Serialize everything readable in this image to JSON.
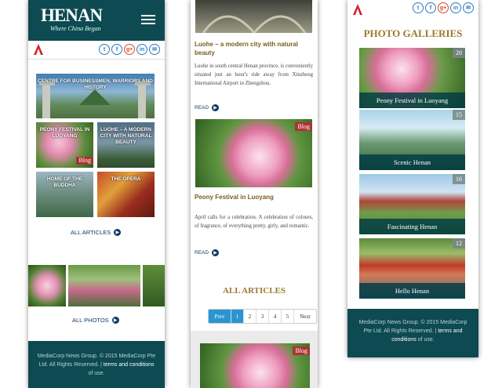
{
  "brand": {
    "logo": "HENAN",
    "tagline": "Where China Began"
  },
  "share_icons": [
    {
      "name": "twitter-icon",
      "glyph": "t"
    },
    {
      "name": "facebook-icon",
      "glyph": "f"
    },
    {
      "name": "googleplus-icon",
      "glyph": "g+"
    },
    {
      "name": "linkedin-icon",
      "glyph": "in"
    },
    {
      "name": "email-icon",
      "glyph": "✉"
    }
  ],
  "home": {
    "tiles": [
      {
        "label": "Centre for Businessmen, Warriors and History"
      },
      {
        "label": "Peony Festival in Luoyang",
        "badge": "Blog"
      },
      {
        "label": "Luohe – a modern city with natural beauty"
      },
      {
        "label": "Home of the Buddha"
      },
      {
        "label": "The Opera"
      }
    ],
    "all_articles": "ALL ARTICLES",
    "all_photos": "ALL PHOTOS"
  },
  "articles": {
    "a1_title": "Luohe – a modern city with natural beauty",
    "a1_text": "Luohe in south central Henan province, is conveniently situated just an hour's ride away from Xinzheng International Airport in Zhengzhou.",
    "read": "READ",
    "badge": "Blog",
    "a2_title": "Peony Festival in Luoyang",
    "a2_text": "April calls for a celebration. A celebration of colours, of fragrance, of everything pretty, girly, and romantic.",
    "section": "ALL ARTICLES",
    "pager": {
      "prev": "Prev",
      "pages": [
        "1",
        "2",
        "3",
        "4",
        "5"
      ],
      "next": "Next"
    }
  },
  "galleries": {
    "heading": "PHOTO GALLERIES",
    "items": [
      {
        "label": "Peony Festival in Luoyang",
        "count": "20"
      },
      {
        "label": "Scenic Henan",
        "count": "15"
      },
      {
        "label": "Fascinating Henan",
        "count": "16"
      },
      {
        "label": "Hello Henan",
        "count": "12"
      }
    ]
  },
  "footer": {
    "text": "MediaCorp News Group. © 2015 MediaCorp Pte Ltd. All Rights Reserved. |",
    "link1": "terms and",
    "link2": "conditions",
    "tail": "of use."
  },
  "colors": {
    "teal": "#0d4a52",
    "gold": "#9a7a2c",
    "navy": "#0d3a66",
    "blue": "#2a95d2"
  }
}
